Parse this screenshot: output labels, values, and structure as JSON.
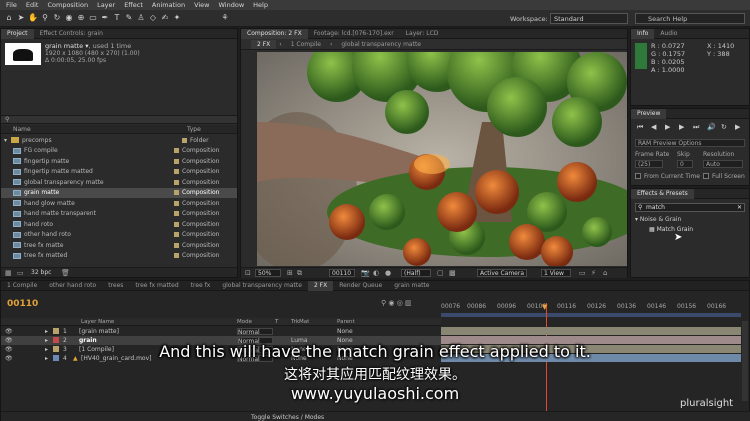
{
  "menu": [
    "File",
    "Edit",
    "Composition",
    "Layer",
    "Effect",
    "Animation",
    "View",
    "Window",
    "Help"
  ],
  "workspace": {
    "label": "Workspace:",
    "value": "Standard"
  },
  "search_help": "Search Help",
  "project": {
    "tabs": [
      "Project",
      "Effect Controls: grain"
    ],
    "item_name": "grain matte ▾",
    "item_used": ", used 1 time",
    "item_size": "1920 x 1080  (480 x 270) (1.00)",
    "item_duration": "Δ 0:00:05, 25.00 fps",
    "col_name": "Name",
    "col_type": "Type",
    "folder": {
      "name": "precomps",
      "type": "Folder"
    },
    "items": [
      {
        "name": "FG compile",
        "type": "Composition"
      },
      {
        "name": "fingertip matte",
        "type": "Composition"
      },
      {
        "name": "fingertip matte matted",
        "type": "Composition"
      },
      {
        "name": "global transparency matte",
        "type": "Composition"
      },
      {
        "name": "grain matte",
        "type": "Composition"
      },
      {
        "name": "hand glow matte",
        "type": "Composition"
      },
      {
        "name": "hand matte transparent",
        "type": "Composition"
      },
      {
        "name": "hand roto",
        "type": "Composition"
      },
      {
        "name": "other hand roto",
        "type": "Composition"
      },
      {
        "name": "tree fx matte",
        "type": "Composition"
      },
      {
        "name": "tree fx matted",
        "type": "Composition"
      }
    ],
    "bpc": "32 bpc"
  },
  "comp_viewer": {
    "tabs": [
      "Composition: 2 FX",
      "Footage: lcd.[076-170].exr",
      "Layer: LCD"
    ],
    "breadcrumb": [
      "2 FX",
      "1 Compile",
      "global transparency matte"
    ],
    "zoom": "50%",
    "timecode": "00110",
    "resolution": "(Half)",
    "camera": "Active Camera",
    "view": "1 View"
  },
  "info": {
    "tabs": [
      "Info",
      "Audio"
    ],
    "r": "R : 0.0727",
    "g": "G : 0.1757",
    "b": "B : 0.0205",
    "a": "A : 1.0000",
    "x": "X : 1410",
    "y": "Y : 388"
  },
  "preview": {
    "tab": "Preview",
    "options": "RAM Preview Options",
    "frame_rate_label": "Frame Rate",
    "frame_rate": "(25)",
    "skip_label": "Skip",
    "skip": "0",
    "resolution_label": "Resolution",
    "resolution": "Auto",
    "from_current": "From Current Time",
    "full_screen": "Full Screen"
  },
  "effects": {
    "tab": "Effects & Presets",
    "search": "match",
    "category": "Noise & Grain",
    "effect": "Match Grain"
  },
  "timeline": {
    "tabs": [
      "1 Compile",
      "other hand roto",
      "trees",
      "tree fx matted",
      "tree fx",
      "global transparency matte",
      "2 FX",
      "Render Queue",
      "grain matte"
    ],
    "timecode": "00110",
    "ruler": [
      "00076",
      "00086",
      "00096",
      "00106",
      "00116",
      "00126",
      "00136",
      "00146",
      "00156",
      "00166"
    ],
    "col_layer": "Layer Name",
    "col_mode": "Mode",
    "col_t": "T",
    "col_trkmat": "TrkMat",
    "col_parent": "Parent",
    "layers": [
      {
        "num": "1",
        "name": "[grain matte]",
        "mode": "Normal",
        "trkmat": "",
        "parent": "None"
      },
      {
        "num": "2",
        "name": "grain",
        "mode": "Normal",
        "trkmat": "Luma",
        "parent": "None"
      },
      {
        "num": "3",
        "name": "[1 Compile]",
        "mode": "Normal",
        "trkmat": "None",
        "parent": "None"
      },
      {
        "num": "4",
        "name": "[HV40_grain_card.mov]",
        "mode": "Normal",
        "trkmat": "None",
        "parent": "None"
      }
    ],
    "toggle": "Toggle Switches / Modes"
  },
  "subtitle": {
    "english": "And this will have the match grain effect applied to it.",
    "chinese": "这将对其应用匹配纹理效果。",
    "url": "www.yuyulaoshi.com"
  },
  "watermark": "pluralsight"
}
